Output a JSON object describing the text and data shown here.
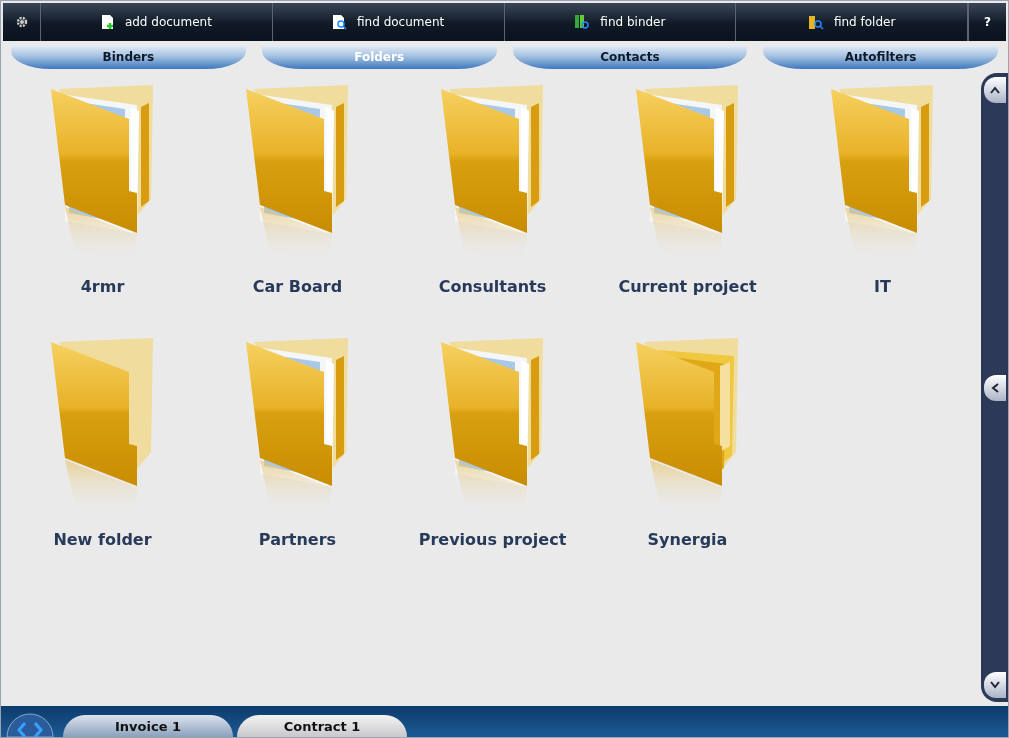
{
  "toolbar": [
    {
      "kind": "add-document",
      "label": "add document"
    },
    {
      "kind": "find-document",
      "label": "find document"
    },
    {
      "kind": "find-binder",
      "label": "find binder"
    },
    {
      "kind": "find-folder",
      "label": "find folder"
    }
  ],
  "help": "?",
  "tabs": [
    {
      "label": "Binders",
      "selected": false
    },
    {
      "label": "Folders",
      "selected": true
    },
    {
      "label": "Contacts",
      "selected": false
    },
    {
      "label": "Autofilters",
      "selected": false
    }
  ],
  "folders": [
    {
      "name": "4rmr",
      "kind": "papers"
    },
    {
      "name": "Car Board",
      "kind": "papers"
    },
    {
      "name": "Consultants",
      "kind": "papers"
    },
    {
      "name": "Current project",
      "kind": "papers"
    },
    {
      "name": "IT",
      "kind": "papers"
    },
    {
      "name": "New folder",
      "kind": "empty"
    },
    {
      "name": "Partners",
      "kind": "papers"
    },
    {
      "name": "Previous project",
      "kind": "papers"
    },
    {
      "name": "Synergia",
      "kind": "subfolders"
    }
  ],
  "document_tabs": [
    {
      "label": "Invoice 1",
      "selected": false
    },
    {
      "label": "Contract 1",
      "selected": true
    }
  ]
}
